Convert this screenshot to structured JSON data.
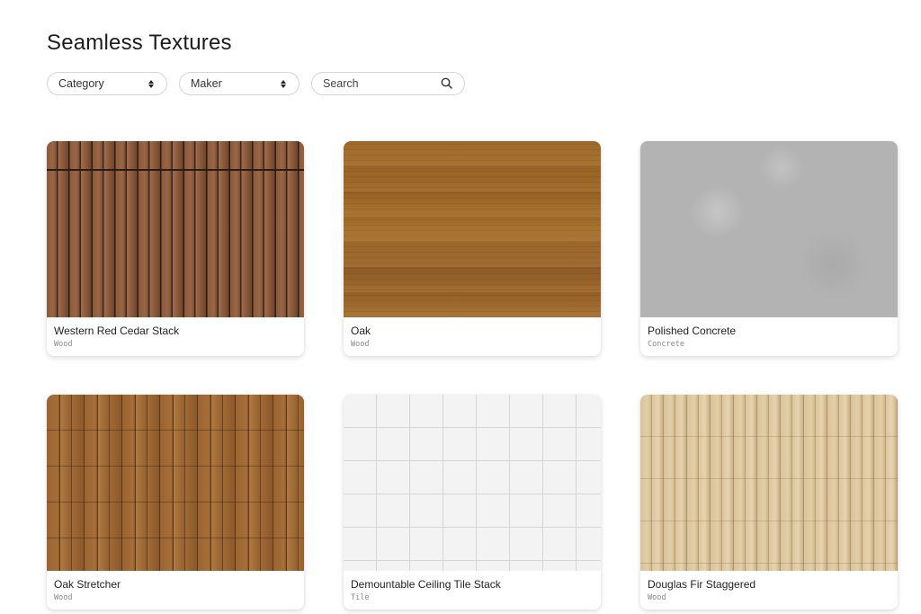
{
  "page": {
    "title": "Seamless Textures"
  },
  "filters": {
    "category_label": "Category",
    "maker_label": "Maker",
    "search_placeholder": "Search",
    "search_icon": "search-icon",
    "select_icon": "updown-arrows-icon"
  },
  "textures": [
    {
      "name": "Western Red Cedar Stack",
      "category": "Wood"
    },
    {
      "name": "Oak",
      "category": "Wood"
    },
    {
      "name": "Polished Concrete",
      "category": "Concrete"
    },
    {
      "name": "Oak Stretcher",
      "category": "Wood"
    },
    {
      "name": "Demountable Ceiling Tile Stack",
      "category": "Tile"
    },
    {
      "name": "Douglas Fir Staggered",
      "category": "Wood"
    }
  ]
}
